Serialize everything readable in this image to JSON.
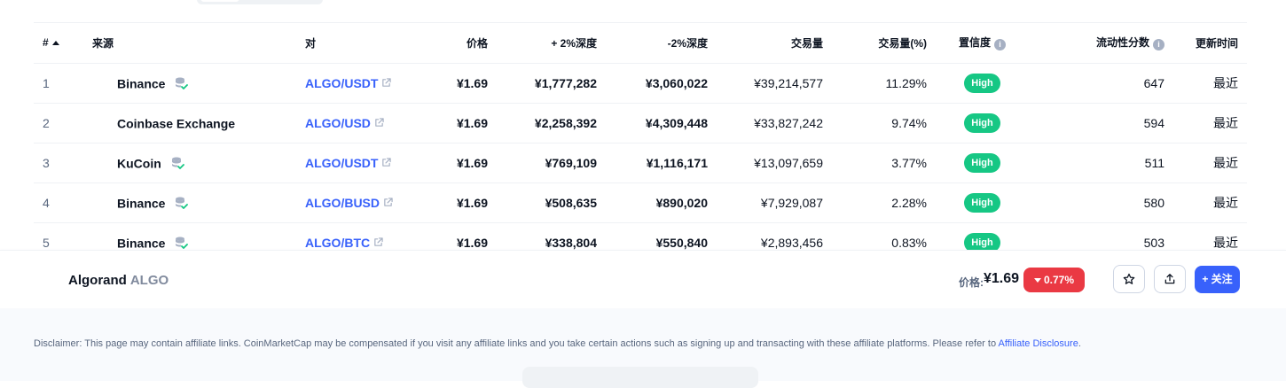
{
  "table": {
    "headers": {
      "rank": "#",
      "source": "来源",
      "pair": "对",
      "price": "价格",
      "plus_depth": "+ 2%深度",
      "minus_depth": "-2%深度",
      "volume": "交易量",
      "volume_pct": "交易量(%)",
      "confidence": "置信度",
      "liquidity": "流动性分数",
      "updated": "更新时间"
    },
    "info_glyph": "i",
    "rows": [
      {
        "rank": "1",
        "source": "Binance",
        "pair": "ALGO/USDT",
        "price": "¥1.69",
        "plus_depth": "¥1,777,282",
        "minus_depth": "¥3,060,022",
        "volume": "¥39,214,577",
        "volume_pct": "11.29%",
        "confidence": "High",
        "liquidity": "647",
        "updated": "最近"
      },
      {
        "rank": "2",
        "source": "Coinbase Exchange",
        "pair": "ALGO/USD",
        "price": "¥1.69",
        "plus_depth": "¥2,258,392",
        "minus_depth": "¥4,309,448",
        "volume": "¥33,827,242",
        "volume_pct": "9.74%",
        "confidence": "High",
        "liquidity": "594",
        "updated": "最近"
      },
      {
        "rank": "3",
        "source": "KuCoin",
        "pair": "ALGO/USDT",
        "price": "¥1.69",
        "plus_depth": "¥769,109",
        "minus_depth": "¥1,116,171",
        "volume": "¥13,097,659",
        "volume_pct": "3.77%",
        "confidence": "High",
        "liquidity": "511",
        "updated": "最近"
      },
      {
        "rank": "4",
        "source": "Binance",
        "pair": "ALGO/BUSD",
        "price": "¥1.69",
        "plus_depth": "¥508,635",
        "minus_depth": "¥890,020",
        "volume": "¥7,929,087",
        "volume_pct": "2.28%",
        "confidence": "High",
        "liquidity": "580",
        "updated": "最近"
      },
      {
        "rank": "5",
        "source": "Binance",
        "pair": "ALGO/BTC",
        "price": "¥1.69",
        "plus_depth": "¥338,804",
        "minus_depth": "¥550,840",
        "volume": "¥2,893,456",
        "volume_pct": "0.83%",
        "confidence": "High",
        "liquidity": "503",
        "updated": "最近"
      }
    ]
  },
  "sticky": {
    "coin_name": "Algorand",
    "coin_symbol": "ALGO",
    "price_label": "价格:",
    "price": "¥1.69",
    "change": "0.77%",
    "follow_label": "+ 关注"
  },
  "footer": {
    "disclaimer": "Disclaimer: This page may contain affiliate links. CoinMarketCap may be compensated if you visit any affiliate links and you take certain actions such as signing up and transacting with these affiliate platforms. Please refer to ",
    "disclosure_link": "Affiliate Disclosure",
    "disclaimer_end": "."
  },
  "colors": {
    "accent": "#3861fb",
    "positive": "#16c784",
    "negative": "#ea3943",
    "text": "#0d1421",
    "muted": "#58667e"
  },
  "icons": [
    "sort-up-icon",
    "verified-exchange-icon",
    "external-link-icon",
    "info-icon",
    "caret-down-icon",
    "star-icon",
    "share-icon"
  ]
}
